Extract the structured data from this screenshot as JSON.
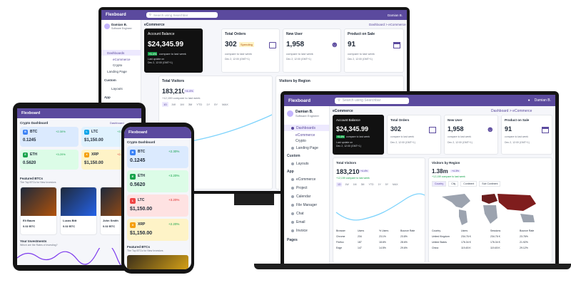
{
  "app": {
    "brand": "Flexboard",
    "search_placeholder": "Search using Searchbar",
    "user_name": "Damian B.",
    "user_role": "Software Engineer",
    "admin_label": "Damian B."
  },
  "sidebar": {
    "dashboards": "Dashboards",
    "ecommerce": "eCommerce",
    "crypto": "Crypto",
    "landing": "Landing Page",
    "custom": "Custom",
    "layouts": "Layouts",
    "app": "App",
    "ecommerce_app": "eCommerce",
    "project": "Project",
    "calendar": "Calendar",
    "file_manager": "File Manager",
    "chat": "Chat",
    "email": "Email",
    "invoice": "Invoice",
    "pages": "Pages"
  },
  "ecom": {
    "title": "eCommerce",
    "breadcrumb": "Dashboard",
    "breadcrumb_current": "eCommerce",
    "balance_title": "Account Balance",
    "balance_value": "$24,345.99",
    "balance_delta": "+5.4%",
    "balance_note": "compare to last week",
    "balance_update": "Last update on",
    "balance_date": "Dec 2, 12:00 (GMT+1)",
    "orders_title": "Total Orders",
    "orders_value": "302",
    "orders_badge": "Spending",
    "orders_note": "compare to last week",
    "orders_update": "Last update on",
    "orders_date": "Dec 2, 12:00 (GMT+1)",
    "user_title": "New User",
    "user_value": "1,958",
    "user_note": "compare to last week",
    "user_update": "Last update on",
    "user_date": "Dec 2, 12:00 (GMT+1)",
    "sale_title": "Product on Sale",
    "sale_value": "91",
    "sale_note": "compare to last week",
    "sale_update": "Last update on",
    "sale_date": "Dec 2, 12:00 (GMT+1)",
    "visitors_title": "Total Visitors",
    "visitors_value": "183,210",
    "visitors_delta": "+4.4%",
    "visitors_note": "+12,159 compare to last week",
    "ranges": [
      "1D",
      "1W",
      "1M",
      "3M",
      "YTD",
      "1Y",
      "5Y",
      "MAX"
    ],
    "region_title": "Visitors by Region",
    "region_value": "1.38m",
    "region_delta": "+4.3%",
    "region_note": "+12,159 compare to last week",
    "region_tabs": [
      "Country",
      "City",
      "Continent",
      "Sub Continent"
    ],
    "browser_headers": [
      "Browser",
      "Users",
      "% Users",
      "Bounce Rate"
    ],
    "browser_rows": [
      [
        "Chrome",
        "234",
        "23.1%",
        "23.8%"
      ],
      [
        "Firefox",
        "187",
        "18.6%",
        "28.6%"
      ],
      [
        "Edge",
        "147",
        "14.5%",
        "29.6%"
      ]
    ],
    "country_headers": [
      "Country",
      "Users",
      "Sessions",
      "Bounce Rate"
    ],
    "country_rows": [
      [
        "United Kingdom",
        "234.76 K",
        "234.76 K",
        "23.76%"
      ],
      [
        "United States",
        "176.34 K",
        "176.34 K",
        "21.92%"
      ],
      [
        "China",
        "119.45 K",
        "119.45 K",
        "29.12%"
      ]
    ]
  },
  "crypto": {
    "title": "Crypto Dashboard",
    "breadcrumb": "Dashboard",
    "coins": [
      {
        "sym": "BTC",
        "delta": "+2.30%",
        "value": "0.1245",
        "color": "#3b82f6",
        "bg": "#dbeafe",
        "dir": "up"
      },
      {
        "sym": "LTC",
        "delta": "+3.20%",
        "value": "$1,150.00",
        "color": "#0ea5e9",
        "bg": "#e0f2fe",
        "dir": "up"
      },
      {
        "sym": "ETH",
        "delta": "+3.20%",
        "value": "0.5620",
        "color": "#16a34a",
        "bg": "#dcfce7",
        "dir": "up"
      },
      {
        "sym": "XRP",
        "delta": "+2.20%",
        "value": "$1,150.00",
        "color": "#f59e0b",
        "bg": "#fef3c7",
        "dir": "down"
      }
    ],
    "phone_coins": [
      {
        "sym": "BTC",
        "delta": "+2.30%",
        "value": "0.1245",
        "color": "#3b82f6",
        "bg": "#dbeafe",
        "dir": "up"
      },
      {
        "sym": "ETH",
        "delta": "+3.20%",
        "value": "0.5620",
        "color": "#16a34a",
        "bg": "#dcfce7",
        "dir": "up"
      },
      {
        "sym": "LTC",
        "delta": "+3.20%",
        "value": "$1,150.00",
        "color": "#ef4444",
        "bg": "#fee2e2",
        "dir": "down"
      },
      {
        "sym": "XRP",
        "delta": "+2.20%",
        "value": "$1,150.00",
        "color": "#f59e0b",
        "bg": "#fef3c7",
        "dir": "up"
      }
    ],
    "featured_title": "Featured BTCs",
    "featured_sub": "The Top BTCs for New Investors",
    "featured_cards": [
      {
        "name": "Eli Baum",
        "price": "0.02 BTC"
      },
      {
        "name": "Lucas Bitt",
        "price": "0.02 BTC"
      },
      {
        "name": "John Smith",
        "price": "0.02 BTC"
      }
    ],
    "invest_title": "Your Investments",
    "invest_sub": "Which are the Rates of Investing?"
  }
}
